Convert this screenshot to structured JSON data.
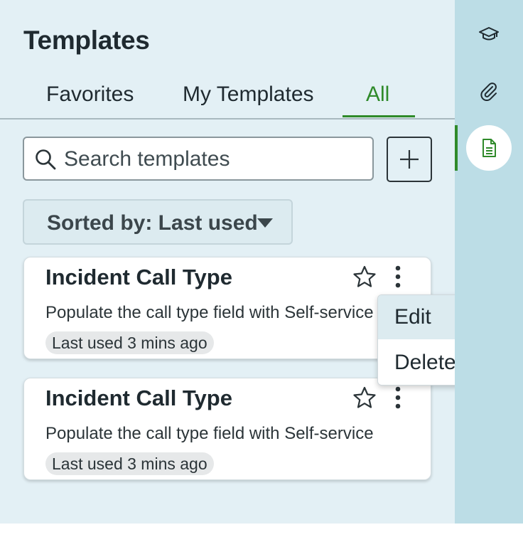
{
  "panel": {
    "title": "Templates",
    "tabs": [
      {
        "label": "Favorites",
        "active": false
      },
      {
        "label": "My Templates",
        "active": false
      },
      {
        "label": "All",
        "active": true
      }
    ],
    "search": {
      "placeholder": "Search templates",
      "value": ""
    },
    "sort_label": "Sorted by: Last used",
    "cards": [
      {
        "title": "Incident Call Type",
        "description": "Populate the call type field with Self-service",
        "badge": "Last used 3 mins ago",
        "favorited": false
      },
      {
        "title": "Incident Call Type",
        "description": "Populate the call type field with Self-service",
        "badge": "Last used 3 mins ago",
        "favorited": false
      }
    ],
    "context_menu": {
      "items": [
        "Edit",
        "Delete"
      ],
      "highlighted": "Edit"
    }
  },
  "rail": {
    "items": [
      {
        "icon": "graduation-cap-icon",
        "active": false
      },
      {
        "icon": "paperclip-icon",
        "active": false
      },
      {
        "icon": "document-icon",
        "active": true
      }
    ]
  },
  "colors": {
    "accent": "#2f8a2a",
    "panel_bg": "#e3f0f5",
    "rail_bg": "#bcdde6",
    "text": "#1f2a30"
  }
}
